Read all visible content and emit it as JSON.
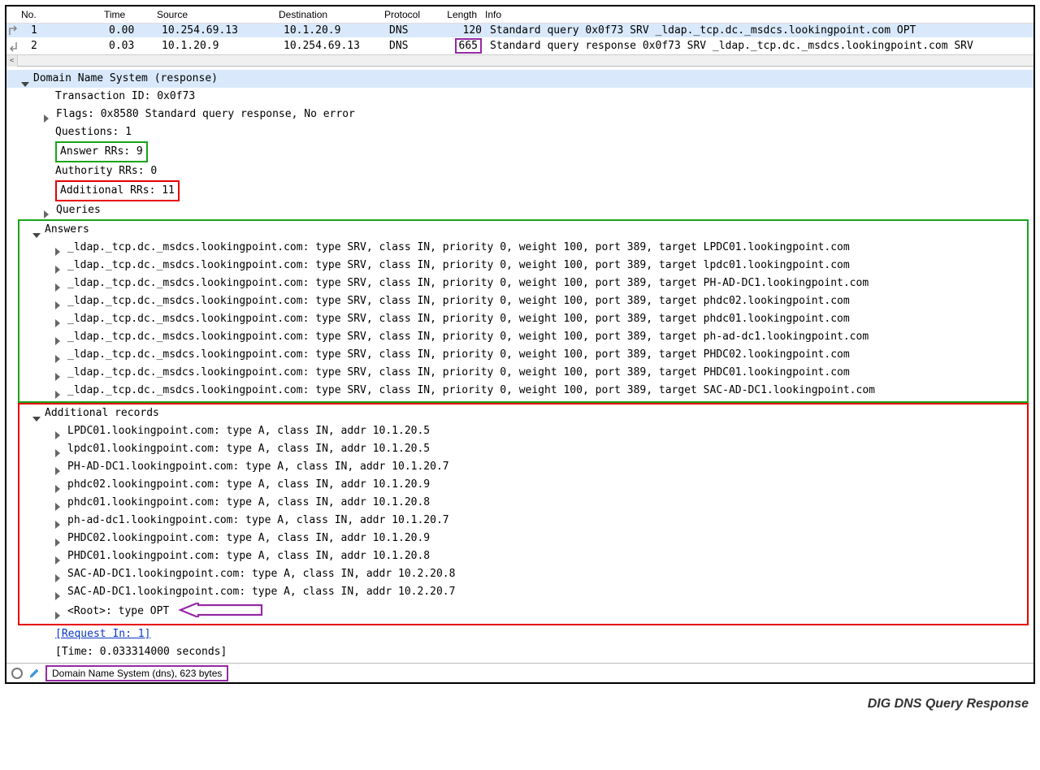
{
  "headers": {
    "no": "No.",
    "time": "Time",
    "source": "Source",
    "destination": "Destination",
    "protocol": "Protocol",
    "length": "Length",
    "info": "Info"
  },
  "packets": [
    {
      "no": "1",
      "time": "0.00",
      "source": "10.254.69.13",
      "destination": "10.1.20.9",
      "protocol": "DNS",
      "length": "120",
      "info": "Standard query 0x0f73 SRV _ldap._tcp.dc._msdcs.lookingpoint.com OPT"
    },
    {
      "no": "2",
      "time": "0.03",
      "source": "10.1.20.9",
      "destination": "10.254.69.13",
      "protocol": "DNS",
      "length": "665",
      "info": "Standard query response 0x0f73 SRV _ldap._tcp.dc._msdcs.lookingpoint.com SRV"
    }
  ],
  "dns": {
    "title": "Domain Name System (response)",
    "transaction": "Transaction ID: 0x0f73",
    "flags": "Flags: 0x8580 Standard query response, No error",
    "questions": "Questions: 1",
    "answer_rrs": "Answer RRs: 9",
    "authority_rrs": "Authority RRs: 0",
    "additional_rrs": "Additional RRs: 11",
    "queries": "Queries",
    "answers_label": "Answers",
    "answers": [
      "_ldap._tcp.dc._msdcs.lookingpoint.com: type SRV, class IN, priority 0, weight 100, port 389, target LPDC01.lookingpoint.com",
      "_ldap._tcp.dc._msdcs.lookingpoint.com: type SRV, class IN, priority 0, weight 100, port 389, target lpdc01.lookingpoint.com",
      "_ldap._tcp.dc._msdcs.lookingpoint.com: type SRV, class IN, priority 0, weight 100, port 389, target PH-AD-DC1.lookingpoint.com",
      "_ldap._tcp.dc._msdcs.lookingpoint.com: type SRV, class IN, priority 0, weight 100, port 389, target phdc02.lookingpoint.com",
      "_ldap._tcp.dc._msdcs.lookingpoint.com: type SRV, class IN, priority 0, weight 100, port 389, target phdc01.lookingpoint.com",
      "_ldap._tcp.dc._msdcs.lookingpoint.com: type SRV, class IN, priority 0, weight 100, port 389, target ph-ad-dc1.lookingpoint.com",
      "_ldap._tcp.dc._msdcs.lookingpoint.com: type SRV, class IN, priority 0, weight 100, port 389, target PHDC02.lookingpoint.com",
      "_ldap._tcp.dc._msdcs.lookingpoint.com: type SRV, class IN, priority 0, weight 100, port 389, target PHDC01.lookingpoint.com",
      "_ldap._tcp.dc._msdcs.lookingpoint.com: type SRV, class IN, priority 0, weight 100, port 389, target SAC-AD-DC1.lookingpoint.com"
    ],
    "additional_label": "Additional records",
    "additional": [
      "LPDC01.lookingpoint.com: type A, class IN, addr 10.1.20.5",
      "lpdc01.lookingpoint.com: type A, class IN, addr 10.1.20.5",
      "PH-AD-DC1.lookingpoint.com: type A, class IN, addr 10.1.20.7",
      "phdc02.lookingpoint.com: type A, class IN, addr 10.1.20.9",
      "phdc01.lookingpoint.com: type A, class IN, addr 10.1.20.8",
      "ph-ad-dc1.lookingpoint.com: type A, class IN, addr 10.1.20.7",
      "PHDC02.lookingpoint.com: type A, class IN, addr 10.1.20.9",
      "PHDC01.lookingpoint.com: type A, class IN, addr 10.1.20.8",
      "SAC-AD-DC1.lookingpoint.com: type A, class IN, addr 10.2.20.8",
      "SAC-AD-DC1.lookingpoint.com: type A, class IN, addr 10.2.20.7",
      "<Root>: type OPT"
    ],
    "request_in": "[Request In: 1]",
    "time": "[Time: 0.033314000 seconds]"
  },
  "status_text": "Domain Name System (dns), 623 bytes",
  "caption": "DIG DNS Query Response"
}
